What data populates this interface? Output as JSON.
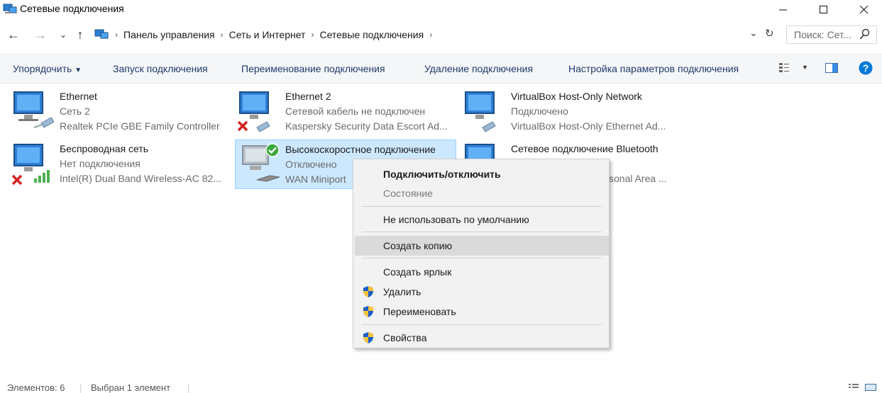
{
  "window": {
    "title": "Сетевые подключения"
  },
  "address": {
    "breadcrumbs": [
      "Панель управления",
      "Сеть и Интернет",
      "Сетевые подключения"
    ],
    "search_placeholder": "Поиск: Сет..."
  },
  "commands": {
    "organize": "Упорядочить",
    "launch": "Запуск подключения",
    "rename": "Переименование подключения",
    "delete": "Удаление подключения",
    "settings": "Настройка параметров подключения"
  },
  "connections": [
    {
      "name": "Ethernet",
      "status": "Сеть  2",
      "device": "Realtek PCIe GBE Family Controller"
    },
    {
      "name": "Ethernet 2",
      "status": "Сетевой кабель не подключен",
      "device": "Kaspersky Security Data Escort Ad..."
    },
    {
      "name": "VirtualBox Host-Only Network",
      "status": "Подключено",
      "device": "VirtualBox Host-Only Ethernet Ad..."
    },
    {
      "name": "Беспроводная сеть",
      "status": "Нет подключения",
      "device": "Intel(R) Dual Band Wireless-AC 82..."
    },
    {
      "name": "Высокоскоростное подключение",
      "status": "Отключено",
      "device": "WAN Miniport"
    },
    {
      "name": "Сетевое подключение Bluetooth",
      "status": "",
      "device": "sonal Area ..."
    }
  ],
  "context_menu": {
    "connect": "Подключить/отключить",
    "state": "Состояние",
    "no_default": "Не использовать по умолчанию",
    "copy": "Создать копию",
    "shortcut": "Создать ярлык",
    "delete": "Удалить",
    "rename": "Переименовать",
    "properties": "Свойства"
  },
  "status": {
    "count": "Элементов: 6",
    "selected": "Выбран 1 элемент"
  },
  "colors": {
    "accent": "#0078d7",
    "selection": "#cce8ff",
    "command_text": "#1e3a6e"
  }
}
